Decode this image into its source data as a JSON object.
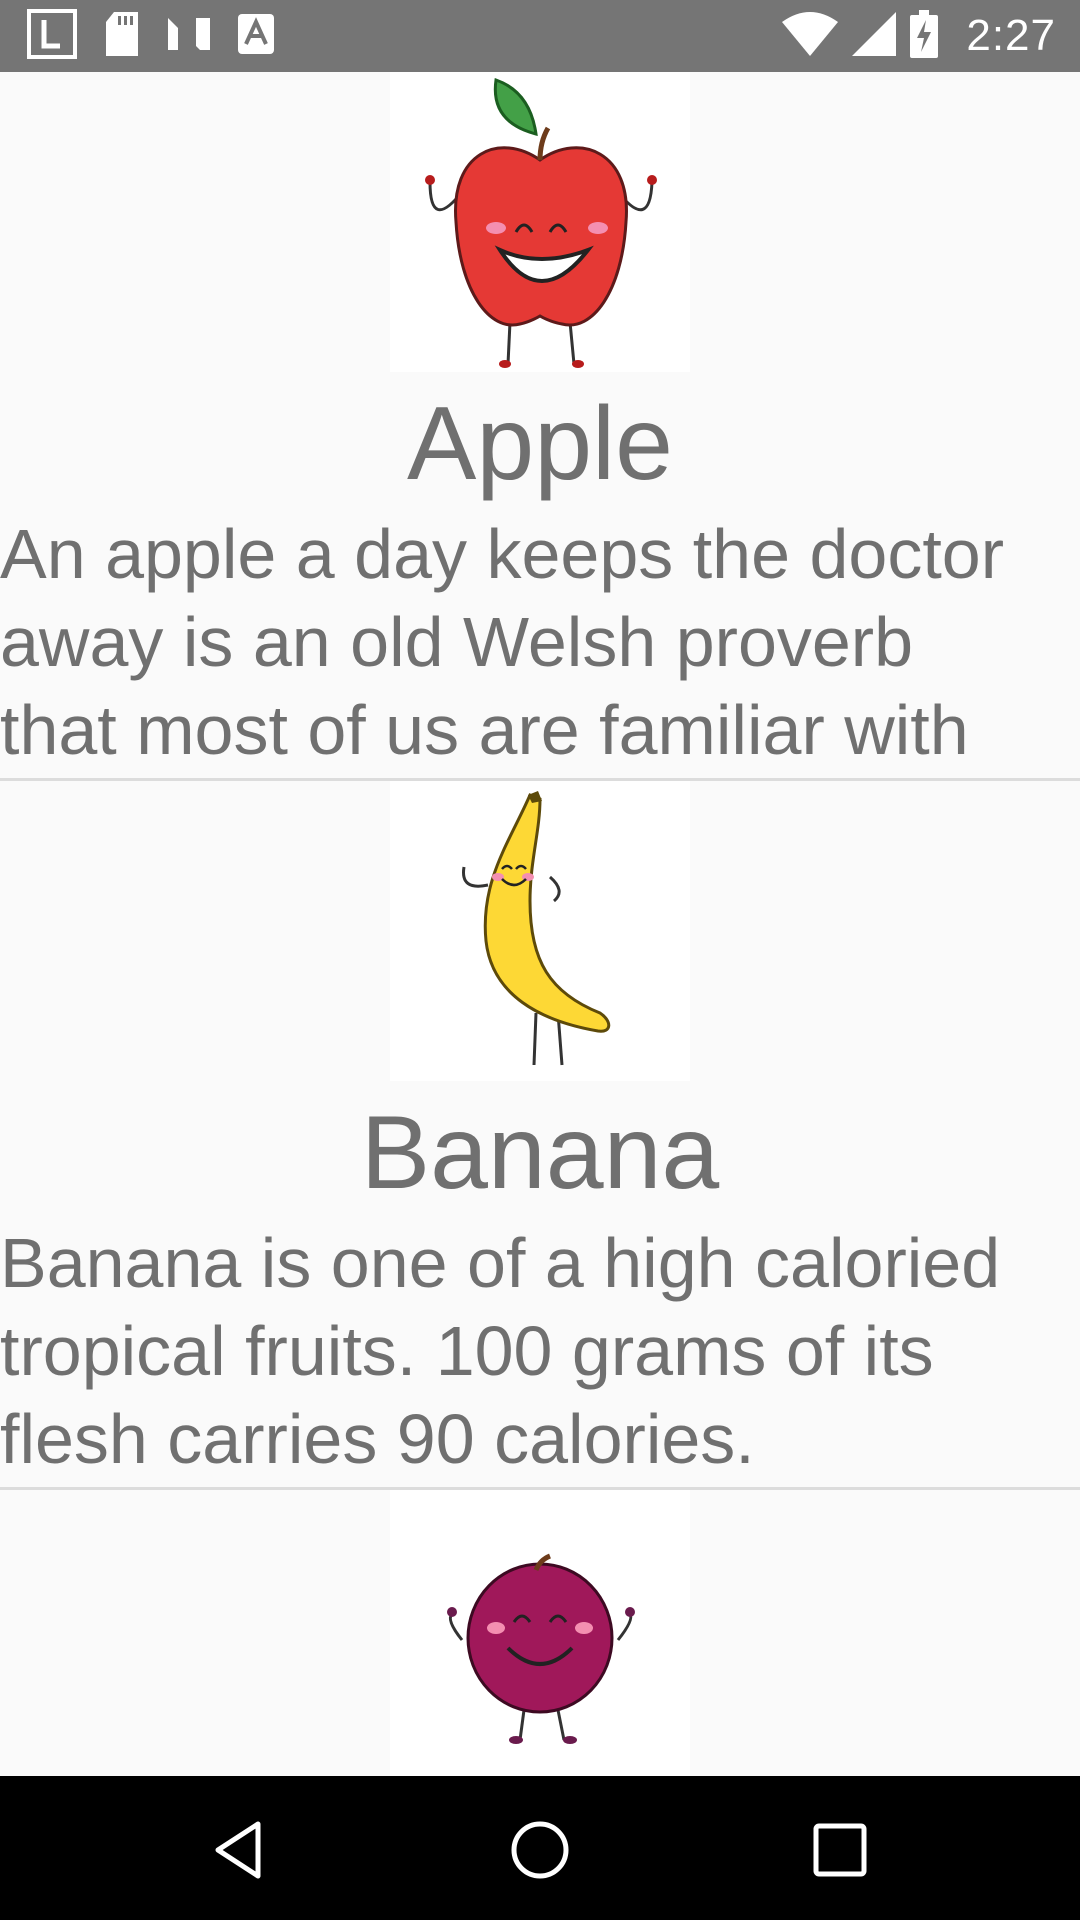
{
  "status_bar": {
    "time": "2:27",
    "left_icons": [
      "launcher-l-icon",
      "sd-card-icon",
      "n-logo-icon",
      "text-a-icon"
    ],
    "right_icons": [
      "wifi-icon",
      "signal-icon",
      "battery-charging-icon"
    ]
  },
  "items": [
    {
      "title": "Apple",
      "description": "An apple a day keeps the doctor\naway is an old Welsh proverb\nthat most of us are familiar with",
      "image_icon": "apple-character-icon",
      "color": "#e53935"
    },
    {
      "title": "Banana",
      "description": "Banana is one of a high caloried\ntropical fruits. 100 grams of its\nflesh carries 90 calories.",
      "image_icon": "banana-character-icon",
      "color": "#fdd835"
    },
    {
      "title": "",
      "description": "",
      "image_icon": "plum-character-icon",
      "color": "#a0185a"
    }
  ],
  "nav_bar": {
    "buttons": [
      "back-icon",
      "home-icon",
      "recents-icon"
    ]
  }
}
